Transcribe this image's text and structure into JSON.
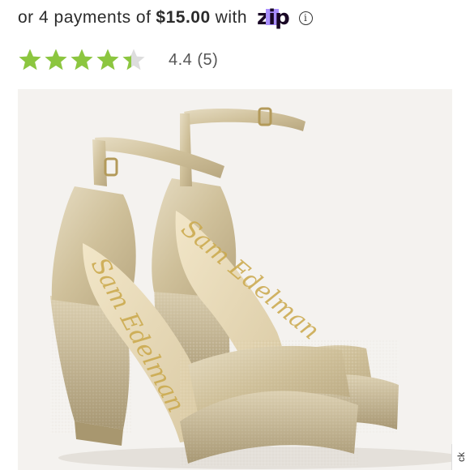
{
  "payment": {
    "prefix": "or 4 payments of",
    "amount": "$15.00",
    "suffix": "with",
    "provider": "zip",
    "info_icon": "info-icon",
    "brand_accent": "#aa8fff",
    "brand_dark": "#1a0826"
  },
  "rating": {
    "stars_value": 4.4,
    "stars_max": 5,
    "text": "4.4 (5)",
    "star_color": "#8cc63f",
    "empty_star_color": "#dddddd"
  },
  "product": {
    "image": "gold-glitter-block-heel-sandal",
    "brand_script": "Sam Edelman"
  },
  "side_tab": {
    "label": "ck"
  }
}
